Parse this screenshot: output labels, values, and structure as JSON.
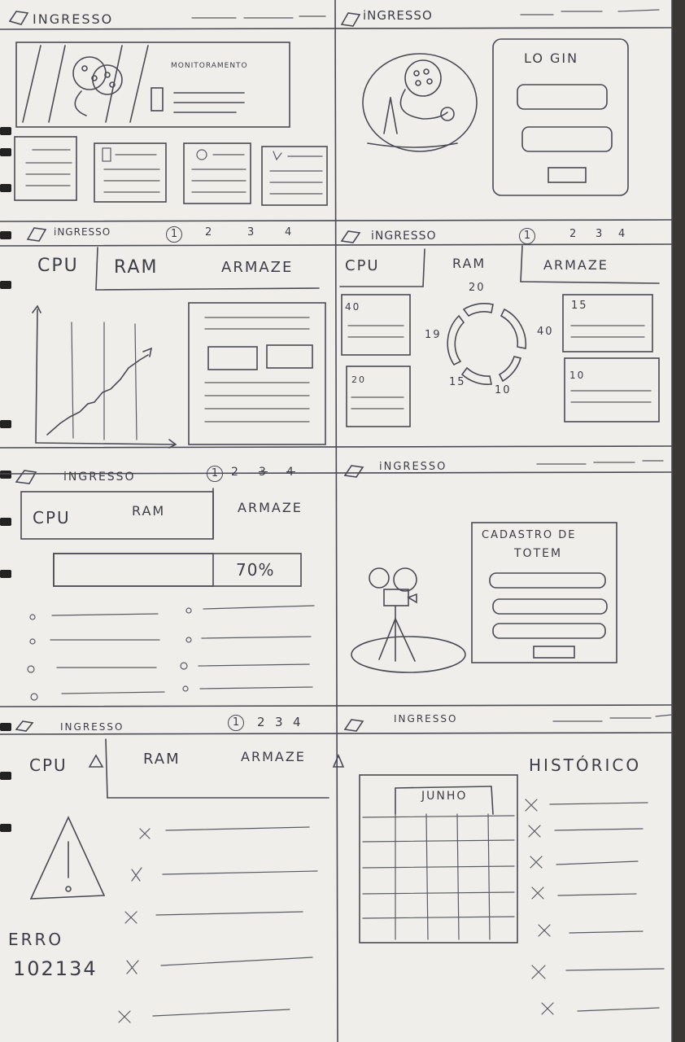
{
  "app": {
    "name": "INGRESSO"
  },
  "panels": {
    "p1": {
      "logo": "INGRESSO",
      "banner_title": "MONITORAMENTO"
    },
    "p2": {
      "logo": "iNGRESSO",
      "login_title": "LO GIN"
    },
    "p3": {
      "logo": "iNGRESSO",
      "pages": [
        "1",
        "2",
        "3",
        "4"
      ],
      "tabs": [
        "CPU",
        "RAM",
        "ARMAZE"
      ]
    },
    "p4": {
      "logo": "iNGRESSO",
      "pages": [
        "1",
        "2",
        "3",
        "4"
      ],
      "tabs": [
        "CPU",
        "RAM",
        "ARMAZE"
      ],
      "card_values": [
        "40",
        "20",
        "15",
        "10"
      ],
      "donut_labels": [
        "20",
        "40",
        "10",
        "15",
        "19"
      ]
    },
    "p5": {
      "logo": "iNGRESSO",
      "pages": [
        "1",
        "2",
        "3",
        "4"
      ],
      "tabs": [
        "CPU",
        "RAM",
        "ARMAZE"
      ],
      "usage": "70%"
    },
    "p6": {
      "logo": "iNGRESSO",
      "form_title_1": "CADASTRO DE",
      "form_title_2": "TOTEM"
    },
    "p7": {
      "logo": "INGRESSO",
      "pages": [
        "1",
        "2",
        "3",
        "4"
      ],
      "tabs": [
        "CPU",
        "RAM",
        "ARMAZE"
      ],
      "error_label": "ERRO",
      "error_code": "102134"
    },
    "p8": {
      "logo": "INGRESSO",
      "calendar_month": "JUNHO",
      "history_title": "HISTÓRICO"
    }
  },
  "colors": {
    "paper": "#efeeeb",
    "ink": "#3d3d48",
    "binding": "#222222"
  }
}
